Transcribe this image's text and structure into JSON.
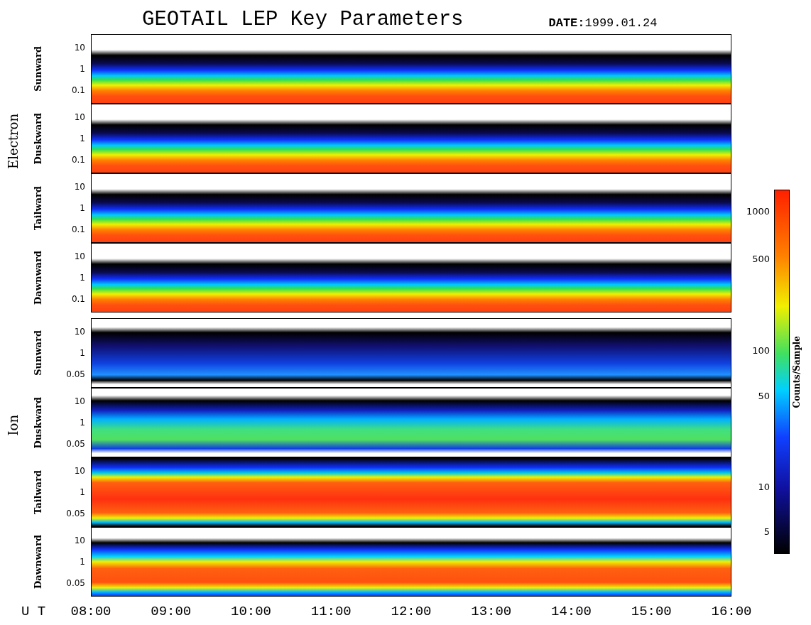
{
  "title": "GEOTAIL LEP Key Parameters",
  "date": {
    "label": "DATE:",
    "value": "1999.01.24"
  },
  "groups": [
    {
      "name": "Electron",
      "panels": [
        {
          "label": "Sunward",
          "yticks": [
            "10",
            "1",
            "0.1"
          ]
        },
        {
          "label": "Duskward",
          "yticks": [
            "10",
            "1",
            "0.1"
          ]
        },
        {
          "label": "Tailward",
          "yticks": [
            "10",
            "1",
            "0.1"
          ]
        },
        {
          "label": "Dawnward",
          "yticks": [
            "10",
            "1",
            "0.1"
          ]
        }
      ]
    },
    {
      "name": "Ion",
      "panels": [
        {
          "label": "Sunward",
          "yticks": [
            "10",
            "1",
            "0.05"
          ]
        },
        {
          "label": "Duskward",
          "yticks": [
            "10",
            "1",
            "0.05"
          ]
        },
        {
          "label": "Tailward",
          "yticks": [
            "10",
            "1",
            "0.05"
          ]
        },
        {
          "label": "Dawnward",
          "yticks": [
            "10",
            "1",
            "0.05"
          ]
        }
      ]
    }
  ],
  "colorbar": {
    "title": "Counts/Sample",
    "ticks": [
      "1000",
      "500",
      "100",
      "50",
      "10",
      "5"
    ]
  },
  "time_axis": {
    "label": "U T",
    "ticks": [
      "08:00",
      "09:00",
      "10:00",
      "11:00",
      "12:00",
      "13:00",
      "14:00",
      "15:00",
      "16:00"
    ]
  }
}
